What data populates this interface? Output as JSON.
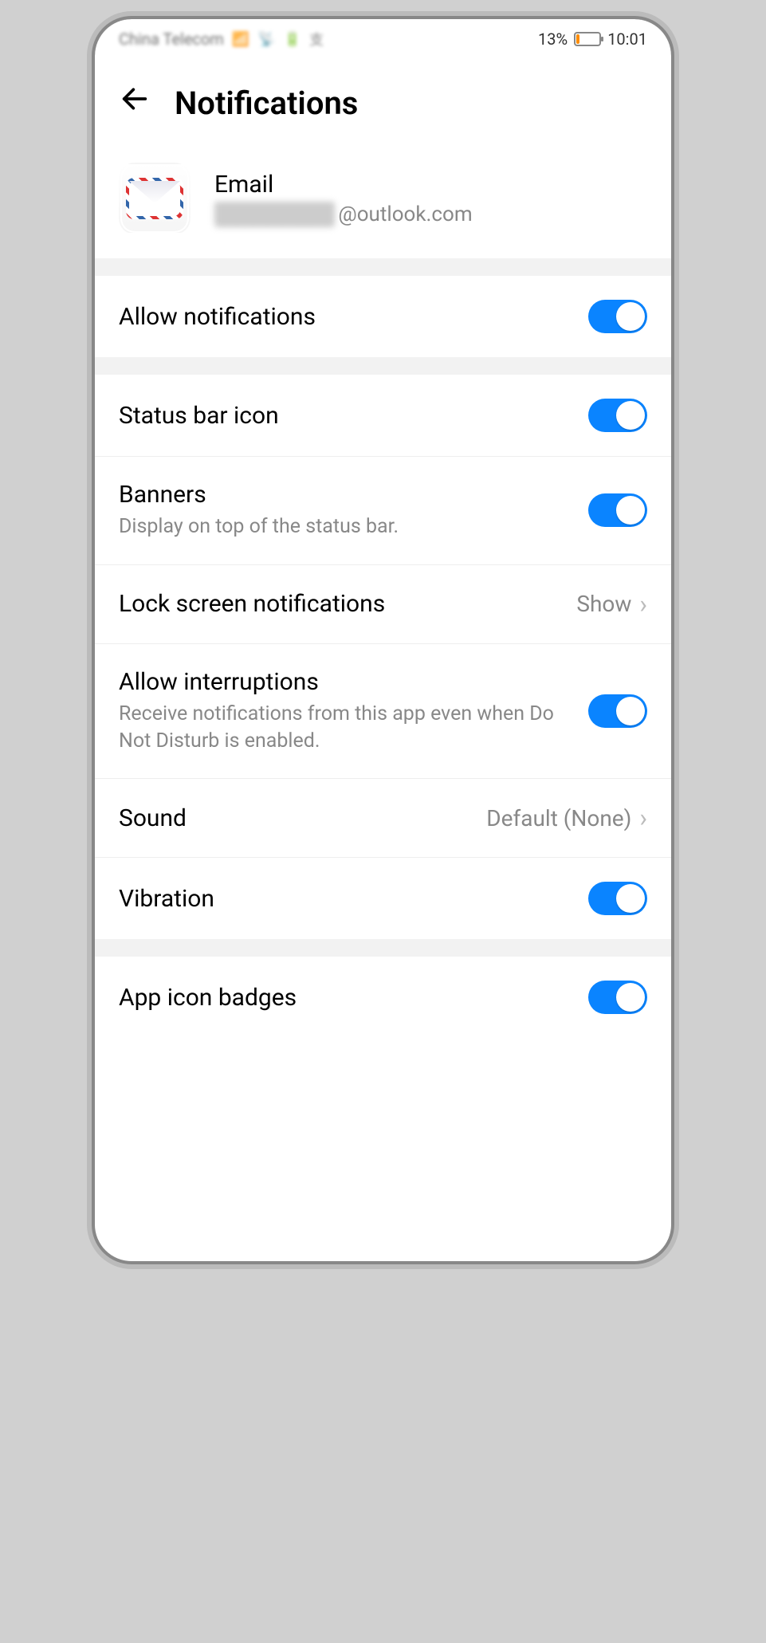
{
  "status_bar": {
    "carrier": "China Telecom",
    "battery_pct": "13%",
    "time": "10:01"
  },
  "header": {
    "title": "Notifications"
  },
  "app": {
    "name": "Email",
    "address_obscured": "████████",
    "address_suffix": "@outlook.com"
  },
  "settings": [
    {
      "key": "allow_notifications",
      "title": "Allow notifications",
      "type": "toggle",
      "value": true
    },
    {
      "key": "status_bar_icon",
      "title": "Status bar icon",
      "type": "toggle",
      "value": true
    },
    {
      "key": "banners",
      "title": "Banners",
      "subtitle": "Display on top of the status bar.",
      "type": "toggle",
      "value": true
    },
    {
      "key": "lock_screen",
      "title": "Lock screen notifications",
      "type": "link",
      "value": "Show"
    },
    {
      "key": "allow_interruptions",
      "title": "Allow interruptions",
      "subtitle": "Receive notifications from this app even when Do Not Disturb is enabled.",
      "type": "toggle",
      "value": true
    },
    {
      "key": "sound",
      "title": "Sound",
      "type": "link",
      "value": "Default (None)"
    },
    {
      "key": "vibration",
      "title": "Vibration",
      "type": "toggle",
      "value": true
    },
    {
      "key": "app_icon_badges",
      "title": "App icon badges",
      "type": "toggle",
      "value": true
    }
  ]
}
